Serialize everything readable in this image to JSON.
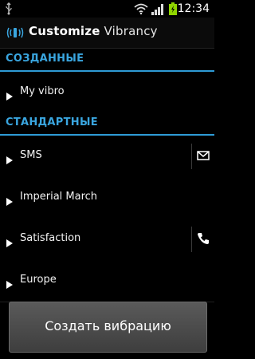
{
  "status_bar": {
    "time": "12:34",
    "icons": [
      "usb-icon",
      "wifi-icon",
      "signal-icon",
      "battery-charging-icon"
    ]
  },
  "app": {
    "title_bold": "Customize",
    "title_light": "Vibrancy",
    "icon": "vibration-icon"
  },
  "sections": [
    {
      "header": "СОЗДАННЫЕ",
      "items": [
        {
          "label": "My vibro"
        }
      ]
    },
    {
      "header": "СТАНДАРТНЫЕ",
      "items": [
        {
          "label": "SMS",
          "action_icon": "message-icon"
        },
        {
          "label": "Imperial March"
        },
        {
          "label": "Satisfaction",
          "action_icon": "phone-icon"
        },
        {
          "label": "Europe"
        }
      ]
    }
  ],
  "create_button": {
    "label": "Создать вибрацию"
  },
  "colors": {
    "accent": "#3aa6e0",
    "background": "#000000",
    "button": "#4a4a4a"
  }
}
